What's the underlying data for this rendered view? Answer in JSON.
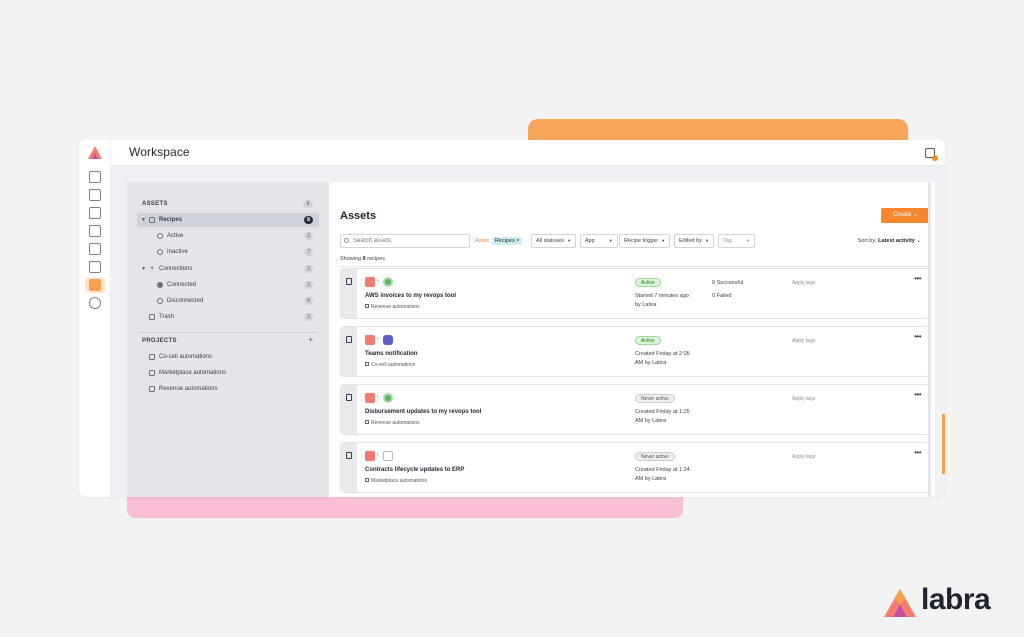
{
  "brand": {
    "wordmark": "labra",
    "accent": "#f7872c"
  },
  "window": {
    "title": "Workspace"
  },
  "rail": {
    "icons": [
      "dashboard-icon",
      "database-icon",
      "handshake-icon",
      "chart-icon",
      "megaphone-icon",
      "puzzle-icon",
      "workspace-icon",
      "settings-icon"
    ]
  },
  "sidebar": {
    "assets_heading": "ASSETS",
    "assets_count": "9",
    "items": [
      {
        "label": "Recipes",
        "count": "8"
      },
      {
        "label": "Active",
        "count": "2"
      },
      {
        "label": "Inactive",
        "count": "7"
      },
      {
        "label": "Connections",
        "count": "2"
      },
      {
        "label": "Connected",
        "count": "2"
      },
      {
        "label": "Disconnected",
        "count": "0"
      },
      {
        "label": "Trash",
        "count": "2"
      }
    ],
    "projects_heading": "PROJECTS",
    "projects_add": "+",
    "projects": [
      "Co-sell automations",
      "Marketplace automations",
      "Revenue automations"
    ]
  },
  "main": {
    "title": "Assets",
    "create_label": "Create",
    "search_placeholder": "Search assets",
    "asset_filter_label": "Asset:",
    "asset_filter_value": "Recipes",
    "asset_filter_remove": "×",
    "filters": [
      "All statuses",
      "App",
      "Recipe trigger",
      "Edited by",
      "Tag"
    ],
    "sort_label": "Sort by:",
    "sort_value": "Latest activity",
    "showing_prefix": "Showing",
    "showing_count": "8",
    "showing_suffix": "recipes"
  },
  "recipes": [
    {
      "name": "AWS invoices to my revops tool",
      "project": "Revenue automations",
      "status": "Active",
      "info1": "Started 7 minutes ago",
      "info2": "by Labra",
      "stat1": "0 Successful",
      "stat2": "0 Failed",
      "tags": "Apply tags",
      "more": "•••"
    },
    {
      "name": "Teams notification",
      "project": "Co-sell automations",
      "status": "Active",
      "info1": "Created Friday at 2:05",
      "info2": "AM by Labra",
      "stat1": "",
      "stat2": "",
      "tags": "Apply tags",
      "more": "•••"
    },
    {
      "name": "Disbursement updates to my revops tool",
      "project": "Revenue automations",
      "status": "Never active",
      "info1": "Created Friday at 1:25",
      "info2": "AM by Labra",
      "stat1": "",
      "stat2": "",
      "tags": "Apply tags",
      "more": "•••"
    },
    {
      "name": "Contracts lifecycle updates to ERP",
      "project": "Marketplace automations",
      "status": "Never active",
      "info1": "Created Friday at 1:24",
      "info2": "AM by Labra",
      "stat1": "",
      "stat2": "",
      "tags": "Apply tags",
      "more": "•••"
    }
  ]
}
